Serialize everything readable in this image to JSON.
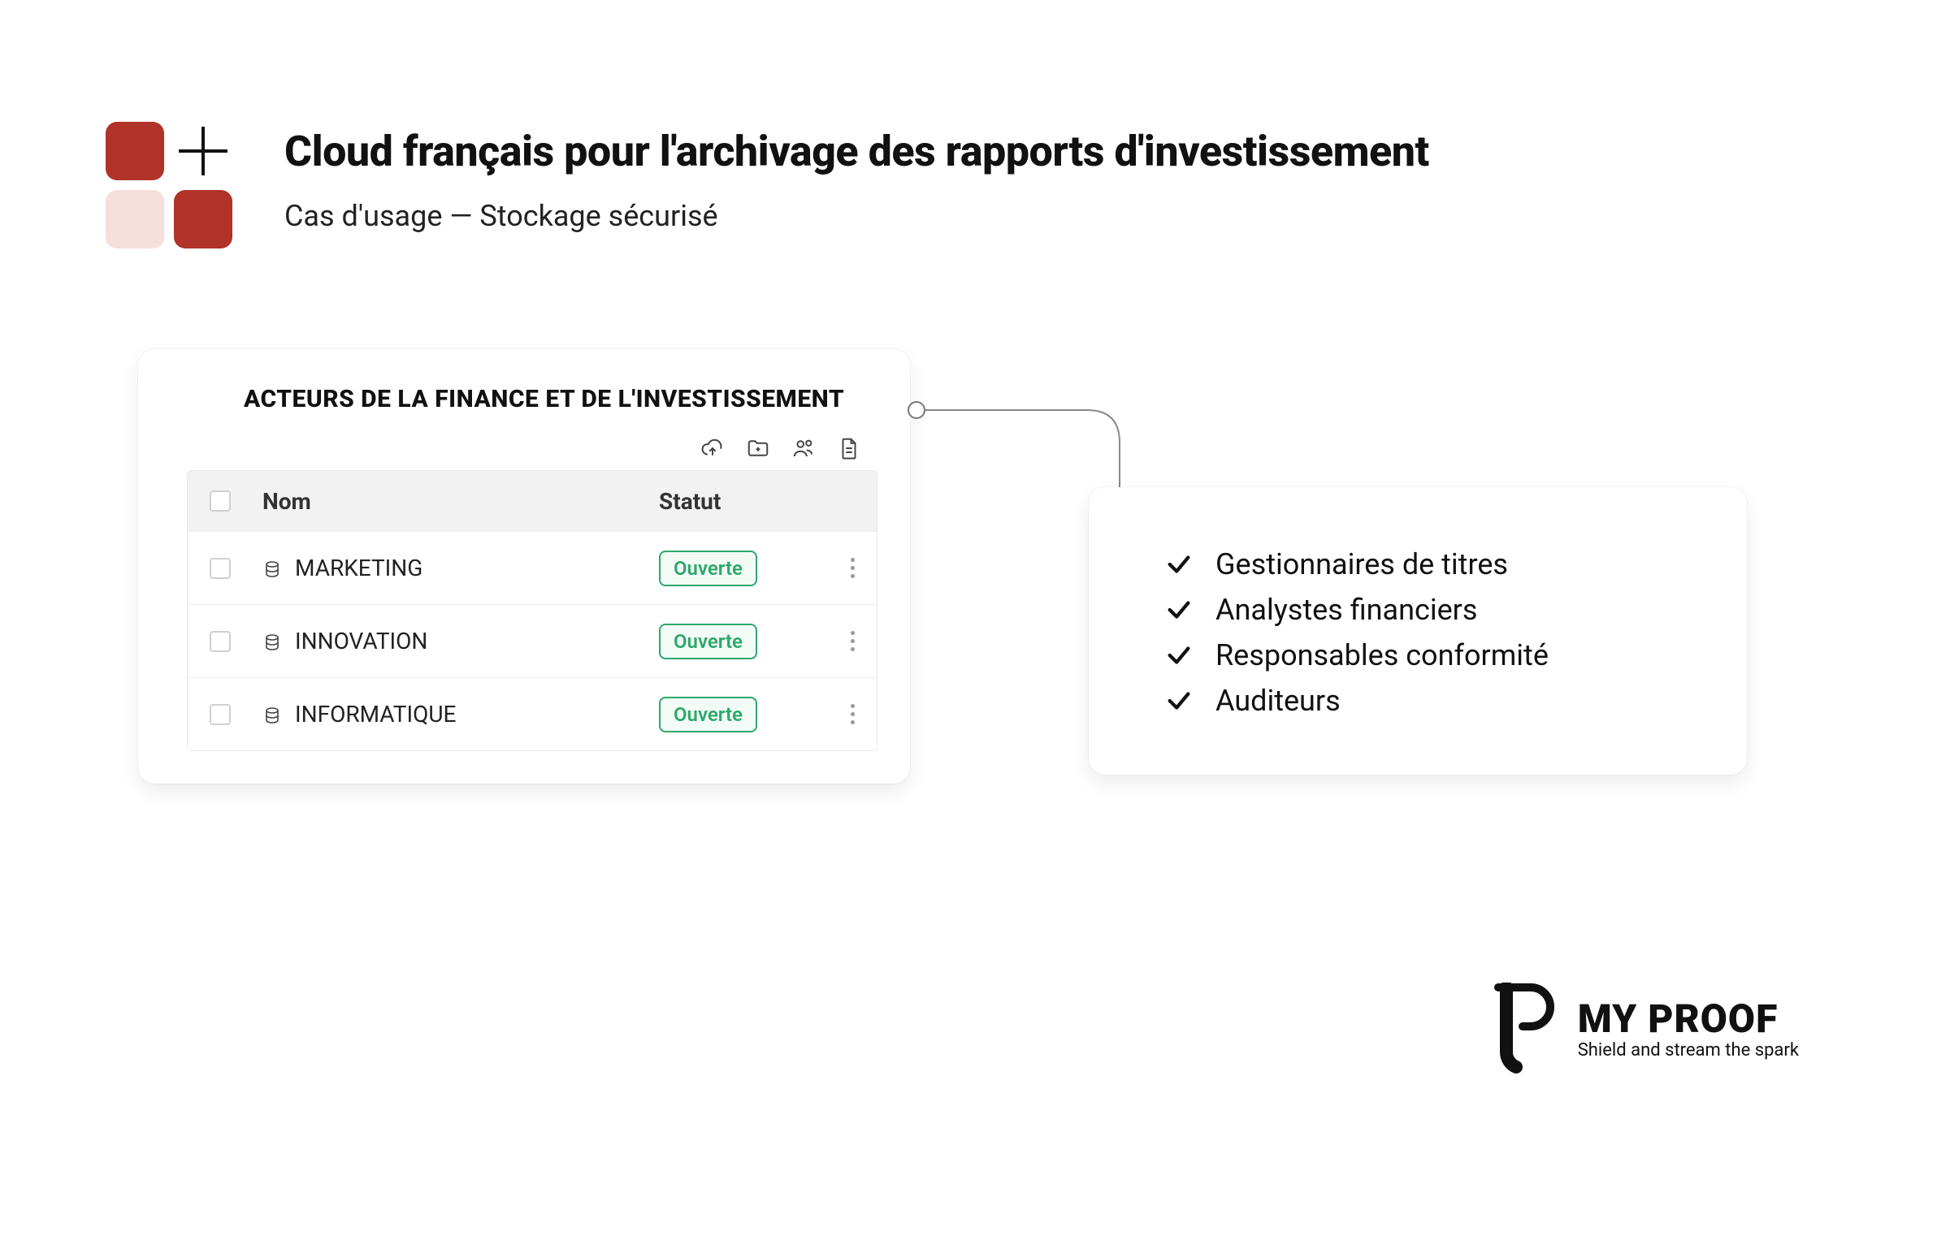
{
  "header": {
    "title": "Cloud français pour l'archivage des rapports d'investissement",
    "subtitle": "Cas d'usage — Stockage sécurisé"
  },
  "left_card": {
    "title": "ACTEURS DE LA FINANCE ET DE L'INVESTISSEMENT",
    "columns": {
      "name": "Nom",
      "status": "Statut"
    },
    "action_icons": [
      "upload-cloud-icon",
      "add-folder-icon",
      "users-icon",
      "document-icon"
    ],
    "rows": [
      {
        "name": "MARKETING",
        "status": "Ouverte"
      },
      {
        "name": "INNOVATION",
        "status": "Ouverte"
      },
      {
        "name": "INFORMATIQUE",
        "status": "Ouverte"
      }
    ]
  },
  "right_card": {
    "items": [
      "Gestionnaires de titres",
      "Analystes financiers",
      "Responsables conformité",
      "Auditeurs"
    ]
  },
  "brand": {
    "name": "MY PROOF",
    "tagline": "Shield and stream the spark"
  }
}
